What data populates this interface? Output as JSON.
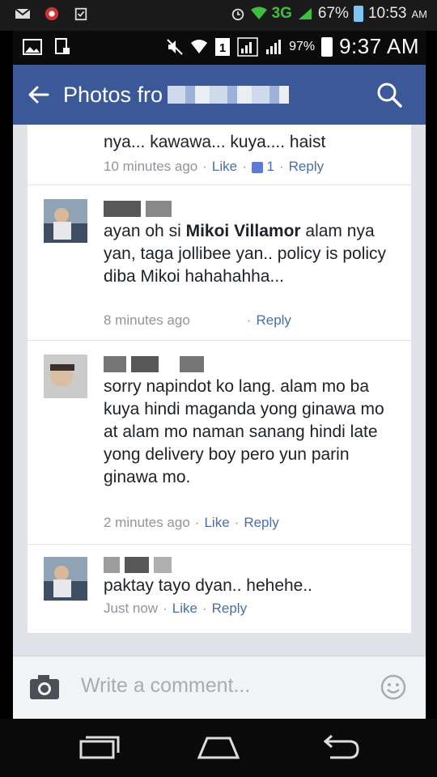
{
  "outer_status": {
    "network": "3G",
    "battery_pct": "67%",
    "time": "10:53",
    "ampm": "AM"
  },
  "inner_status": {
    "battery_pct": "97%",
    "time": "9:37 AM"
  },
  "appbar": {
    "title": "Photos fro",
    "back_icon": "arrow-left-icon",
    "search_icon": "search-icon"
  },
  "comments": [
    {
      "text_partial": "nya... kawawa... kuya.... haist",
      "time": "10 minutes ago",
      "like": "Like",
      "like_count": "1",
      "reply": "Reply"
    },
    {
      "text_before": "ayan oh si ",
      "mention": "Mikoi Villamor",
      "text_after": " alam nya yan, taga jollibee yan.. policy is policy diba Mikoi hahahahha...",
      "time": "8 minutes ago",
      "reply": "Reply"
    },
    {
      "text": "sorry napindot ko lang.  alam mo ba kuya hindi maganda yong ginawa mo at alam mo naman sanang hindi late yong delivery boy pero yun parin ginawa mo.",
      "time": "2 minutes ago",
      "like": "Like",
      "reply": "Reply"
    },
    {
      "text": "paktay tayo dyan..  hehehe..",
      "time": "Just now",
      "like": "Like",
      "reply": "Reply"
    }
  ],
  "composer": {
    "placeholder": "Write a comment...",
    "camera_icon": "camera-icon",
    "emoji_icon": "smiley-icon"
  },
  "navbar": {
    "icons": [
      "recent-apps-icon",
      "home-icon",
      "back-icon"
    ]
  }
}
